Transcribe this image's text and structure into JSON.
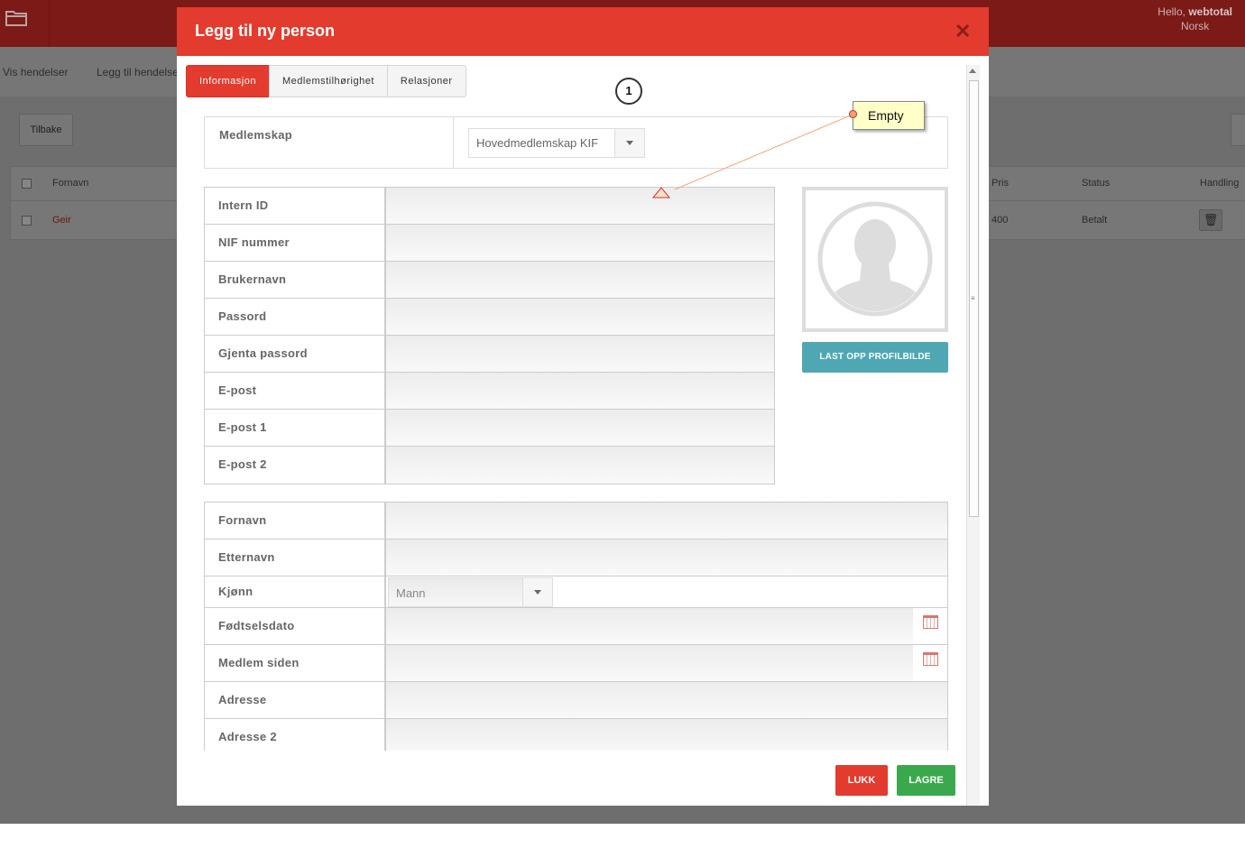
{
  "background": {
    "user_greeting": "Hello,",
    "user_name": "webtotal",
    "language": "Norsk",
    "subnav": [
      "Vis hendelser",
      "Legg til hendelse"
    ],
    "back_button": "Tilbake",
    "table_headers": [
      "Fornavn",
      "Pris",
      "Status",
      "Handling"
    ],
    "row": {
      "first_name": "Geir",
      "price": "400",
      "status": "Betalt"
    }
  },
  "modal": {
    "title": "Legg til ny person",
    "close_symbol": "✕",
    "tabs": [
      "Informasjon",
      "Medlemstilhørighet",
      "Relasjoner"
    ],
    "active_tab": "Informasjon",
    "annotation_number": "1",
    "annotation_note": "Empty",
    "membership": {
      "label": "Medlemskap",
      "value": "Hovedmedlemskap KIF"
    },
    "account_fields": [
      "Intern ID",
      "NIF nummer",
      "Brukernavn",
      "Passord",
      "Gjenta passord",
      "E-post",
      "E-post 1",
      "E-post 2"
    ],
    "personal_fields": {
      "first_name": "Fornavn",
      "last_name": "Etternavn",
      "gender": "Kjønn",
      "gender_value": "Mann",
      "birth_date": "Fødtselsdato",
      "member_since": "Medlem siden",
      "address": "Adresse",
      "address2": "Adresse 2"
    },
    "upload_button": "LAST OPP PROFILBILDE",
    "buttons": {
      "close": "LUKK",
      "save": "LAGRE"
    }
  },
  "colors": {
    "accent": "#e33b2e",
    "save": "#3aa94d",
    "upload": "#4fa7b3"
  }
}
